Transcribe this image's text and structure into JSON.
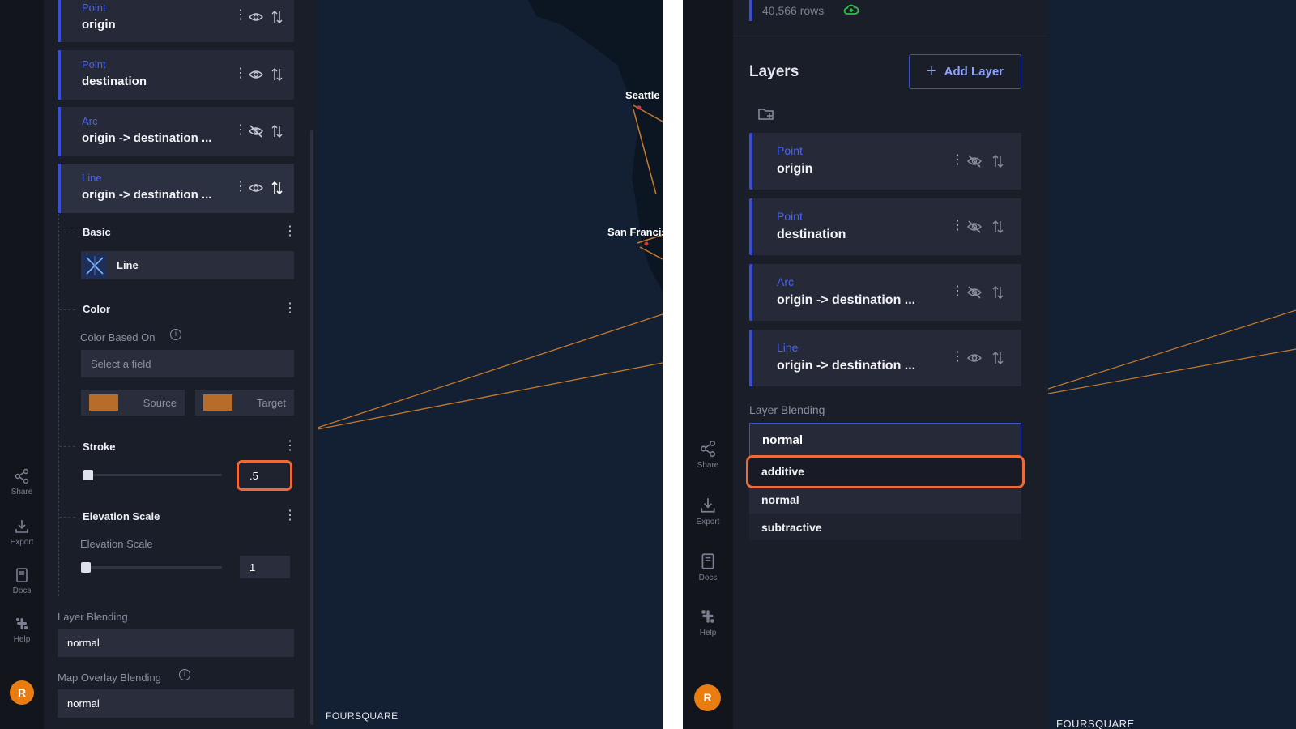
{
  "left": {
    "layers": [
      {
        "type": "Point",
        "name": "origin",
        "visible": true
      },
      {
        "type": "Point",
        "name": "destination",
        "visible": true
      },
      {
        "type": "Arc",
        "name": "origin -> destination ...",
        "visible": false
      },
      {
        "type": "Line",
        "name": "origin -> destination ...",
        "visible": true
      }
    ],
    "basic": {
      "title": "Basic",
      "layer_type": "Line"
    },
    "color": {
      "title": "Color",
      "based_on_label": "Color Based On",
      "field_placeholder": "Select a field",
      "source_label": "Source",
      "target_label": "Target",
      "source_color": "#b86c2a",
      "target_color": "#b86c2a"
    },
    "stroke": {
      "title": "Stroke",
      "value": ".5"
    },
    "elevation": {
      "title": "Elevation Scale",
      "label": "Elevation Scale",
      "value": "1"
    },
    "layer_blending": {
      "label": "Layer Blending",
      "value": "normal"
    },
    "overlay_blending": {
      "label": "Map Overlay Blending",
      "value": "normal"
    },
    "map": {
      "cities": [
        "Seattle",
        "San Francis"
      ],
      "brand": "FOURSQUARE"
    },
    "rail": {
      "share": "Share",
      "export": "Export",
      "docs": "Docs",
      "help": "Help",
      "avatar": "R"
    }
  },
  "right": {
    "rows_text": "40,566 rows",
    "layers_title": "Layers",
    "add_layer_label": "Add Layer",
    "layers": [
      {
        "type": "Point",
        "name": "origin",
        "visible": false
      },
      {
        "type": "Point",
        "name": "destination",
        "visible": false
      },
      {
        "type": "Arc",
        "name": "origin -> destination ...",
        "visible": false
      },
      {
        "type": "Line",
        "name": "origin -> destination ...",
        "visible": true
      }
    ],
    "layer_blending": {
      "label": "Layer Blending",
      "value": "normal",
      "options": [
        "additive",
        "normal",
        "subtractive"
      ],
      "highlighted": "additive"
    },
    "rail": {
      "share": "Share",
      "export": "Export",
      "docs": "Docs",
      "help": "Help",
      "avatar": "R"
    },
    "brand": "FOURSQUARE"
  },
  "colors": {
    "accent": "#3a4fd6",
    "arc_line": "#c47a2c",
    "highlight": "#ee6a3a",
    "avatar": "#ea7d12",
    "cloud": "#2fbf4a"
  }
}
